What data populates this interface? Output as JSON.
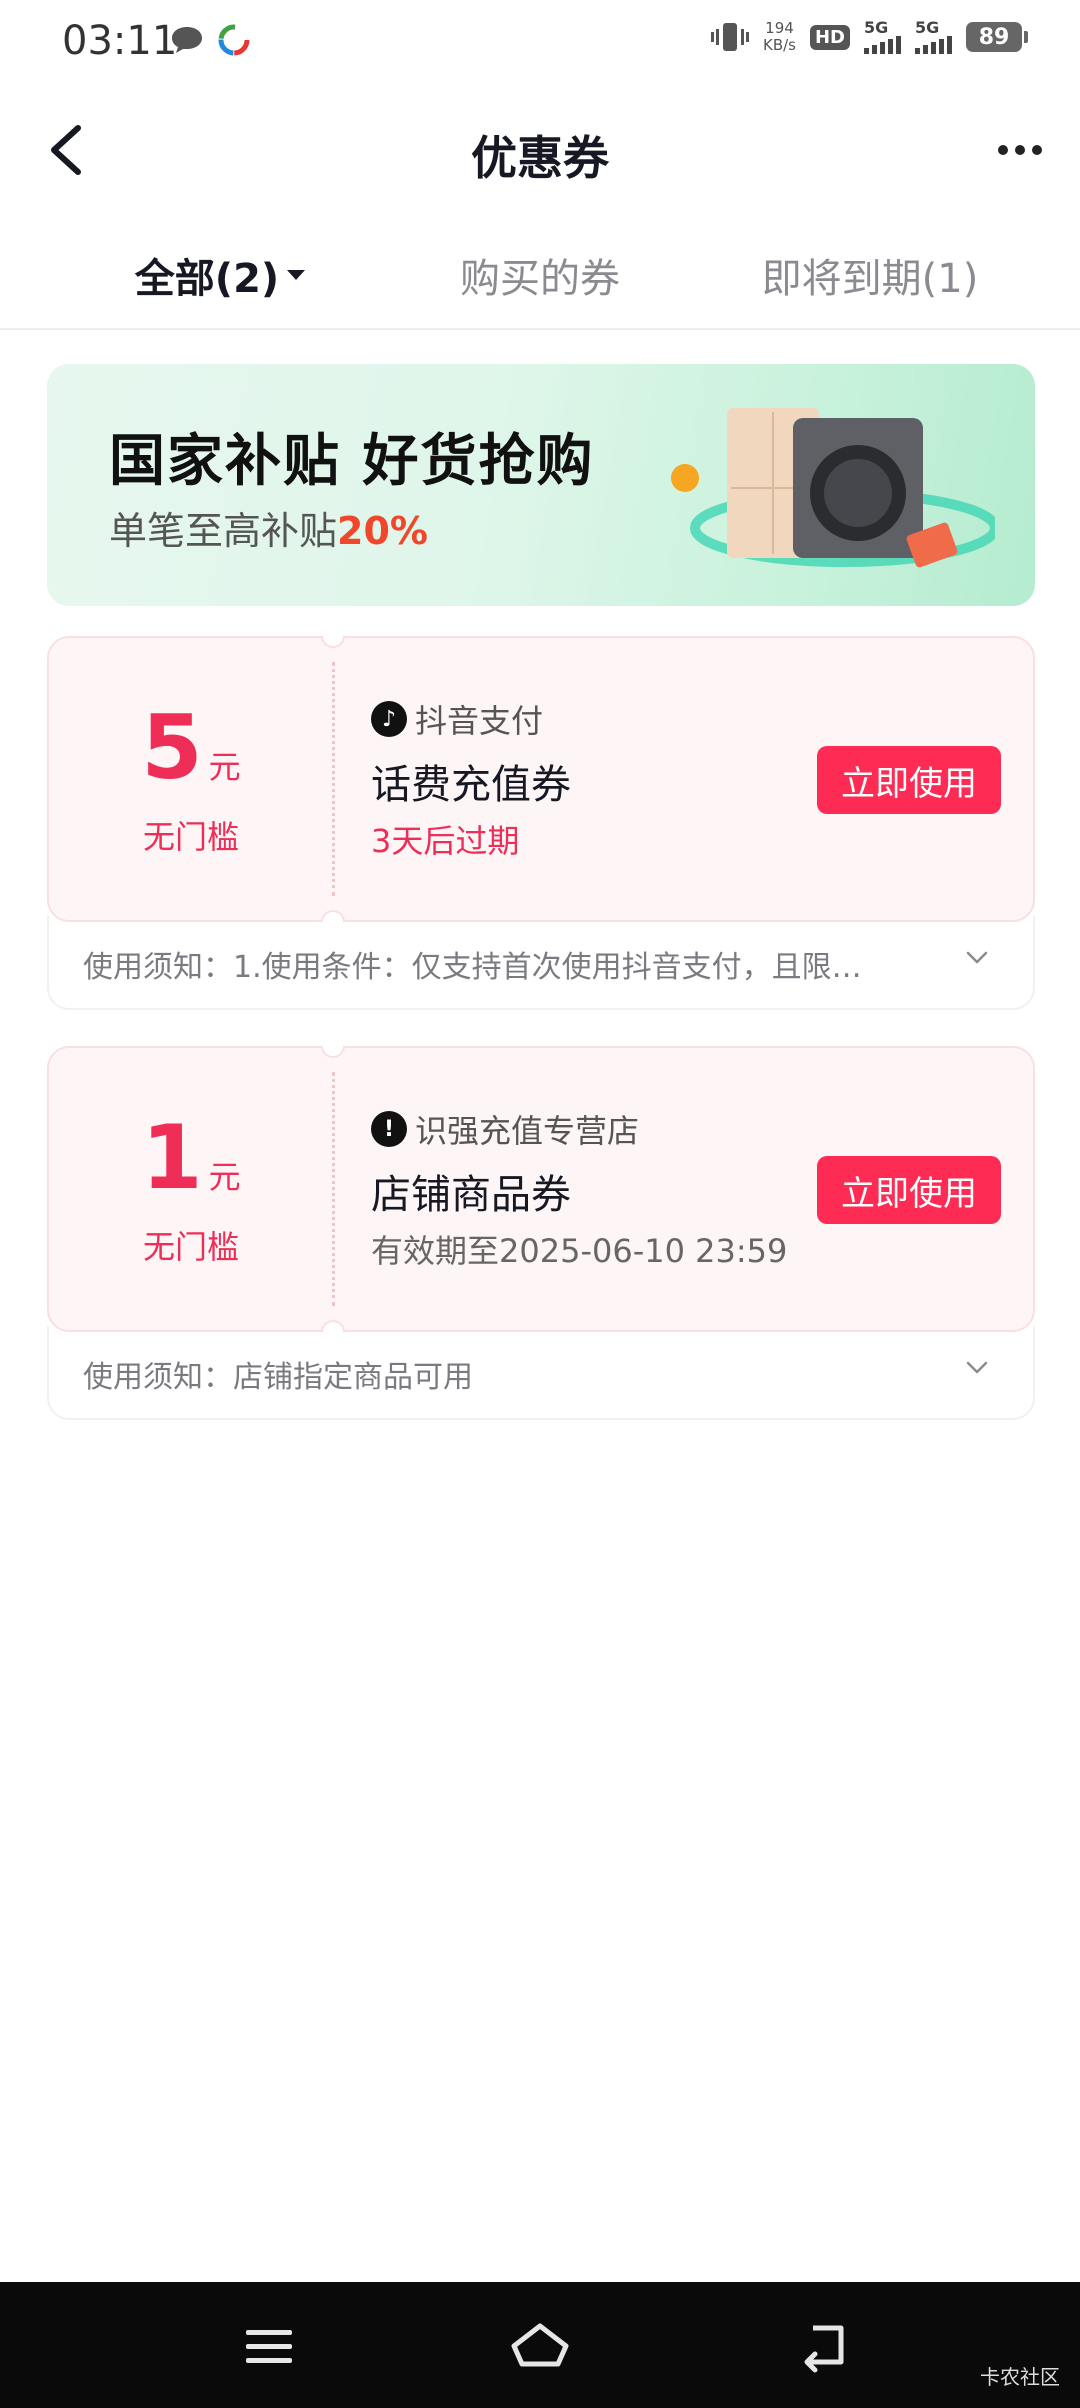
{
  "status_bar": {
    "time": "03:11",
    "net_speed_value": "194",
    "net_speed_unit": "KB/s",
    "hd_badge": "HD",
    "signal1_label": "5G",
    "signal2_label": "5G",
    "battery": "89"
  },
  "header": {
    "title": "优惠券"
  },
  "tabs": [
    {
      "label": "全部(2)"
    },
    {
      "label": "购买的券"
    },
    {
      "label": "即将到期(1)"
    }
  ],
  "banner": {
    "title": "国家补贴 好货抢购",
    "subtitle_prefix": "单笔至高补贴",
    "subtitle_accent": "20%"
  },
  "coupons": [
    {
      "amount": "5",
      "unit": "元",
      "threshold": "无门槛",
      "merchant": "抖音支付",
      "name": "话费充值券",
      "expiry": "3天后过期",
      "expiry_color": "#ee2e57",
      "button": "立即使用",
      "notes": "使用须知：1.使用条件：仅支持首次使用抖音支付，且限…"
    },
    {
      "amount": "1",
      "unit": "元",
      "threshold": "无门槛",
      "merchant": "识强充值专营店",
      "name": "店铺商品券",
      "expiry": "有效期至2025-06-10 23:59",
      "expiry_color": "#666666",
      "button": "立即使用",
      "notes": "使用须知：店铺指定商品可用"
    }
  ],
  "system_nav": {
    "watermark": "卡农社区"
  },
  "colors": {
    "accent": "#fe2c55",
    "amount": "#ee2e57",
    "banner_accent": "#f0472c"
  }
}
